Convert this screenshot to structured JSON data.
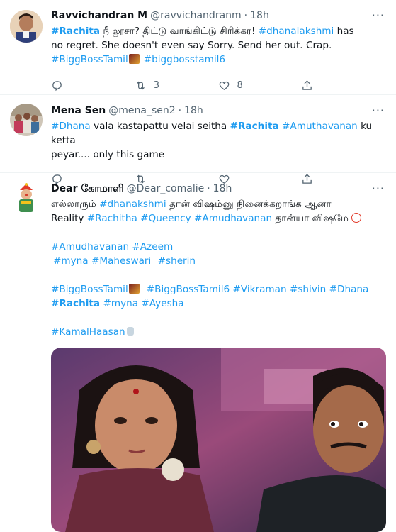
{
  "tweets": [
    {
      "name": "Ravvichandran M",
      "handle": "@ravvichandranm",
      "sep": "·",
      "time": "18h",
      "line1": {
        "t1": "#Rachita",
        "t2": " நீ லூசா? திட்டு வாங்கிட்டு சிரிக்கர! ",
        "t3": "#dhanalakshmi",
        "t4": " has"
      },
      "line2": "no regret. She doesn't even say Sorry. Send her out. Crap.",
      "line3": {
        "t1": "#BiggBossTamil",
        "t2": "#biggbosstamil6"
      },
      "actions": {
        "reply": "",
        "retweet": "3",
        "like": "8"
      }
    },
    {
      "name": "Mena Sen",
      "handle": "@mena_sen2",
      "sep": "·",
      "time": "18h",
      "line1": {
        "t1": "#Dhana",
        "t2": " vala kastapattu velai seitha  ",
        "t3": "#Rachita",
        "t4": " ",
        "t5": "#Amuthavanan",
        "t6": " ku ketta"
      },
      "line2": "peyar.... only this game",
      "actions": {
        "reply": "",
        "retweet": "",
        "like": ""
      }
    },
    {
      "name": "Dear கோமாளி",
      "handle": "@Dear_comalie",
      "sep": "·",
      "time": "18h",
      "line1": {
        "t1": "எல்லாரும் ",
        "t2": "#dhanakshmi",
        "t3": " தான் விஷம்னு நினைக்கறாங்க ஆனா"
      },
      "line2": {
        "t1": "Reality ",
        "t2": "#Rachitha",
        "t3": "#Queency",
        "t4": "#Amudhavanan",
        "t5": " தான்யா விஷமே "
      },
      "line3": {
        "t1": "#Amudhavanan",
        "t2": "#Azeem"
      },
      "line4": {
        "t1": "#myna",
        "t2": "#Maheswari",
        "t3": "#sherin"
      },
      "line5": {
        "t1": "#BiggBossTamil",
        "t2": "#BiggBossTamil6",
        "t3": "#Vikraman",
        "t4": "#shivin",
        "t5": "#Dhana"
      },
      "line6": {
        "t1": "#Rachita",
        "t2": "#myna",
        "t3": "#Ayesha"
      },
      "line7": "#KamalHaasan"
    }
  ],
  "more_icon": "more-horizontal-icon",
  "colors": {
    "link": "#1d9bf0",
    "text": "#0f1419",
    "muted": "#536471",
    "border": "#eff3f4"
  }
}
